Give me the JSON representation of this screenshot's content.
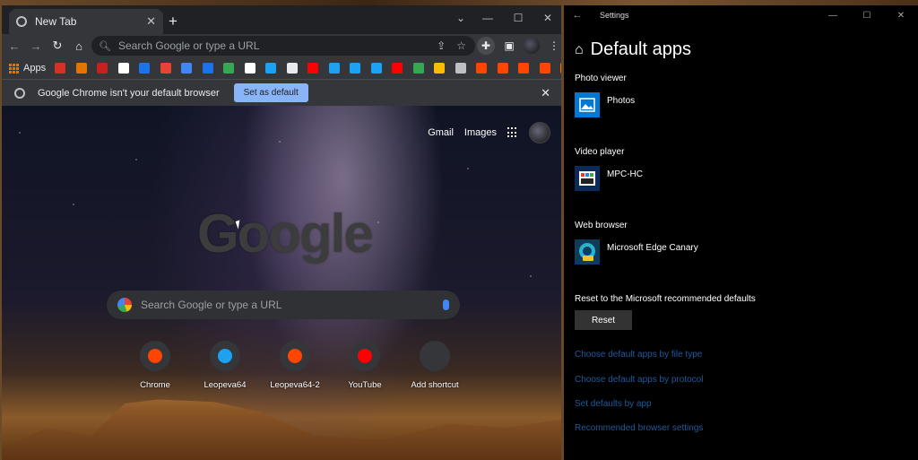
{
  "chrome": {
    "tab_title": "New Tab",
    "new_tab": "+",
    "tab_close": "✕",
    "win_min": "—",
    "win_max": "☐",
    "win_close": "✕",
    "win_chevron": "⌄",
    "back": "←",
    "forward": "→",
    "reload": "↻",
    "home": "⌂",
    "omnibox_placeholder": "Search Google or type a URL",
    "apps_label": "Apps",
    "bookmarks_more": "»",
    "bookmark_colors": [
      "#d93025",
      "#e37400",
      "#c5221f",
      "#ffffff",
      "#1a73e8",
      "#ea4335",
      "#4285f4",
      "#1a73e8",
      "#34a853",
      "#ffffff",
      "#1da1f2",
      "#e8eaed",
      "#ff0000",
      "#1da1f2",
      "#1da1f2",
      "#1da1f2",
      "#ff0000",
      "#34a853",
      "#fbbc05",
      "#bdc1c6",
      "#ff4500",
      "#ff4500",
      "#ff4500",
      "#ff4500",
      "#ff6d00"
    ],
    "infobar_text": "Google Chrome isn't your default browser",
    "set_default": "Set as default",
    "infobar_close": "✕"
  },
  "ntp": {
    "gmail": "Gmail",
    "images": "Images",
    "logo": "Google",
    "search_placeholder": "Search Google or type a URL",
    "shortcuts": [
      {
        "label": "Chrome",
        "color": "#ff4500",
        "icon": "reddit-icon"
      },
      {
        "label": "Leopeva64",
        "color": "#1da1f2",
        "icon": "twitter-icon"
      },
      {
        "label": "Leopeva64-2",
        "color": "#ff4500",
        "icon": "reddit-icon"
      },
      {
        "label": "YouTube",
        "color": "#ff0000",
        "icon": "youtube-icon"
      },
      {
        "label": "Add shortcut",
        "color": "#35363a",
        "icon": "add-icon"
      }
    ]
  },
  "settings": {
    "window_title": "Settings",
    "page_title": "Default apps",
    "photo_label": "Photo viewer",
    "photo_app": "Photos",
    "video_label": "Video player",
    "video_app": "MPC-HC",
    "web_label": "Web browser",
    "web_app": "Microsoft Edge Canary",
    "reset_label": "Reset to the Microsoft recommended defaults",
    "reset_button": "Reset",
    "links": [
      "Choose default apps by file type",
      "Choose default apps by protocol",
      "Set defaults by app",
      "Recommended browser settings"
    ]
  }
}
